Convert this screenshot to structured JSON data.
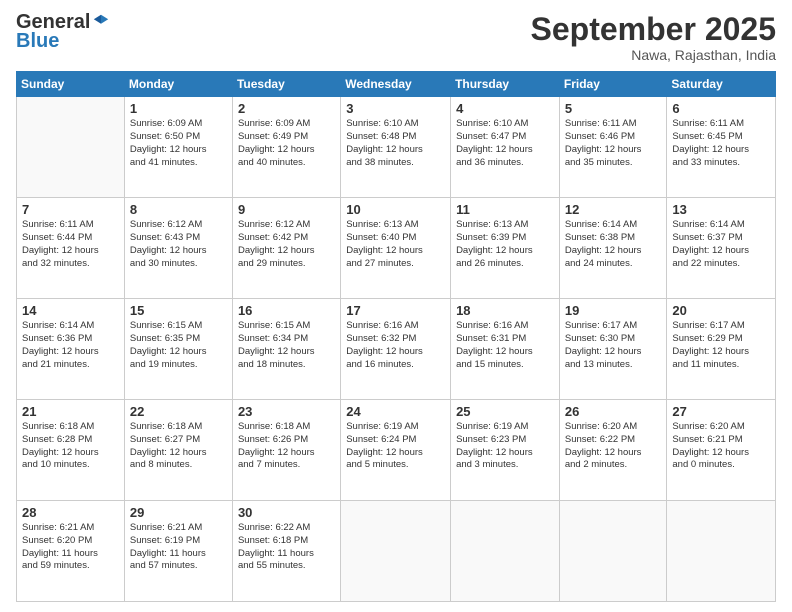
{
  "logo": {
    "general": "General",
    "blue": "Blue"
  },
  "header": {
    "title": "September 2025",
    "subtitle": "Nawa, Rajasthan, India"
  },
  "weekdays": [
    "Sunday",
    "Monday",
    "Tuesday",
    "Wednesday",
    "Thursday",
    "Friday",
    "Saturday"
  ],
  "weeks": [
    [
      {
        "day": "",
        "info": ""
      },
      {
        "day": "1",
        "info": "Sunrise: 6:09 AM\nSunset: 6:50 PM\nDaylight: 12 hours\nand 41 minutes."
      },
      {
        "day": "2",
        "info": "Sunrise: 6:09 AM\nSunset: 6:49 PM\nDaylight: 12 hours\nand 40 minutes."
      },
      {
        "day": "3",
        "info": "Sunrise: 6:10 AM\nSunset: 6:48 PM\nDaylight: 12 hours\nand 38 minutes."
      },
      {
        "day": "4",
        "info": "Sunrise: 6:10 AM\nSunset: 6:47 PM\nDaylight: 12 hours\nand 36 minutes."
      },
      {
        "day": "5",
        "info": "Sunrise: 6:11 AM\nSunset: 6:46 PM\nDaylight: 12 hours\nand 35 minutes."
      },
      {
        "day": "6",
        "info": "Sunrise: 6:11 AM\nSunset: 6:45 PM\nDaylight: 12 hours\nand 33 minutes."
      }
    ],
    [
      {
        "day": "7",
        "info": "Sunrise: 6:11 AM\nSunset: 6:44 PM\nDaylight: 12 hours\nand 32 minutes."
      },
      {
        "day": "8",
        "info": "Sunrise: 6:12 AM\nSunset: 6:43 PM\nDaylight: 12 hours\nand 30 minutes."
      },
      {
        "day": "9",
        "info": "Sunrise: 6:12 AM\nSunset: 6:42 PM\nDaylight: 12 hours\nand 29 minutes."
      },
      {
        "day": "10",
        "info": "Sunrise: 6:13 AM\nSunset: 6:40 PM\nDaylight: 12 hours\nand 27 minutes."
      },
      {
        "day": "11",
        "info": "Sunrise: 6:13 AM\nSunset: 6:39 PM\nDaylight: 12 hours\nand 26 minutes."
      },
      {
        "day": "12",
        "info": "Sunrise: 6:14 AM\nSunset: 6:38 PM\nDaylight: 12 hours\nand 24 minutes."
      },
      {
        "day": "13",
        "info": "Sunrise: 6:14 AM\nSunset: 6:37 PM\nDaylight: 12 hours\nand 22 minutes."
      }
    ],
    [
      {
        "day": "14",
        "info": "Sunrise: 6:14 AM\nSunset: 6:36 PM\nDaylight: 12 hours\nand 21 minutes."
      },
      {
        "day": "15",
        "info": "Sunrise: 6:15 AM\nSunset: 6:35 PM\nDaylight: 12 hours\nand 19 minutes."
      },
      {
        "day": "16",
        "info": "Sunrise: 6:15 AM\nSunset: 6:34 PM\nDaylight: 12 hours\nand 18 minutes."
      },
      {
        "day": "17",
        "info": "Sunrise: 6:16 AM\nSunset: 6:32 PM\nDaylight: 12 hours\nand 16 minutes."
      },
      {
        "day": "18",
        "info": "Sunrise: 6:16 AM\nSunset: 6:31 PM\nDaylight: 12 hours\nand 15 minutes."
      },
      {
        "day": "19",
        "info": "Sunrise: 6:17 AM\nSunset: 6:30 PM\nDaylight: 12 hours\nand 13 minutes."
      },
      {
        "day": "20",
        "info": "Sunrise: 6:17 AM\nSunset: 6:29 PM\nDaylight: 12 hours\nand 11 minutes."
      }
    ],
    [
      {
        "day": "21",
        "info": "Sunrise: 6:18 AM\nSunset: 6:28 PM\nDaylight: 12 hours\nand 10 minutes."
      },
      {
        "day": "22",
        "info": "Sunrise: 6:18 AM\nSunset: 6:27 PM\nDaylight: 12 hours\nand 8 minutes."
      },
      {
        "day": "23",
        "info": "Sunrise: 6:18 AM\nSunset: 6:26 PM\nDaylight: 12 hours\nand 7 minutes."
      },
      {
        "day": "24",
        "info": "Sunrise: 6:19 AM\nSunset: 6:24 PM\nDaylight: 12 hours\nand 5 minutes."
      },
      {
        "day": "25",
        "info": "Sunrise: 6:19 AM\nSunset: 6:23 PM\nDaylight: 12 hours\nand 3 minutes."
      },
      {
        "day": "26",
        "info": "Sunrise: 6:20 AM\nSunset: 6:22 PM\nDaylight: 12 hours\nand 2 minutes."
      },
      {
        "day": "27",
        "info": "Sunrise: 6:20 AM\nSunset: 6:21 PM\nDaylight: 12 hours\nand 0 minutes."
      }
    ],
    [
      {
        "day": "28",
        "info": "Sunrise: 6:21 AM\nSunset: 6:20 PM\nDaylight: 11 hours\nand 59 minutes."
      },
      {
        "day": "29",
        "info": "Sunrise: 6:21 AM\nSunset: 6:19 PM\nDaylight: 11 hours\nand 57 minutes."
      },
      {
        "day": "30",
        "info": "Sunrise: 6:22 AM\nSunset: 6:18 PM\nDaylight: 11 hours\nand 55 minutes."
      },
      {
        "day": "",
        "info": ""
      },
      {
        "day": "",
        "info": ""
      },
      {
        "day": "",
        "info": ""
      },
      {
        "day": "",
        "info": ""
      }
    ]
  ]
}
